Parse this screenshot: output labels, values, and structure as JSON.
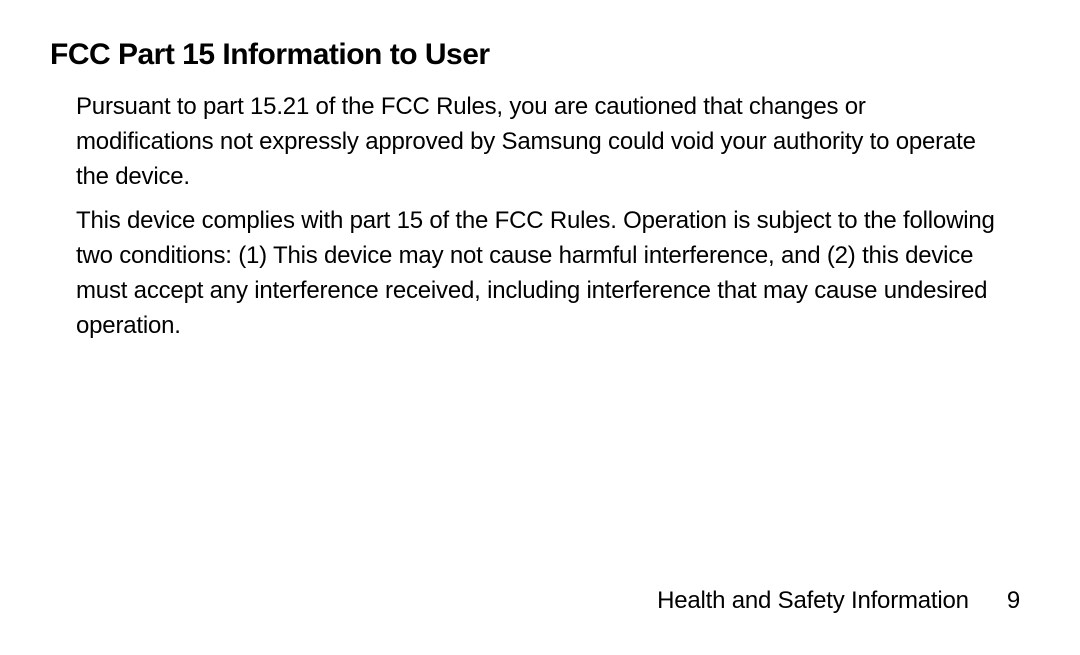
{
  "heading": "FCC Part 15 Information to User",
  "paragraphs": [
    "Pursuant to part 15.21 of the FCC Rules, you are cautioned that changes or modifications not expressly approved by Samsung could void your authority to operate the device.",
    "This device complies with part 15 of the FCC Rules. Operation is subject to the following two conditions: (1) This device may not cause harmful interference, and (2) this device must accept any interference received, including interference that may cause undesired operation."
  ],
  "footer": {
    "label": "Health and Safety Information",
    "page_number": "9"
  }
}
